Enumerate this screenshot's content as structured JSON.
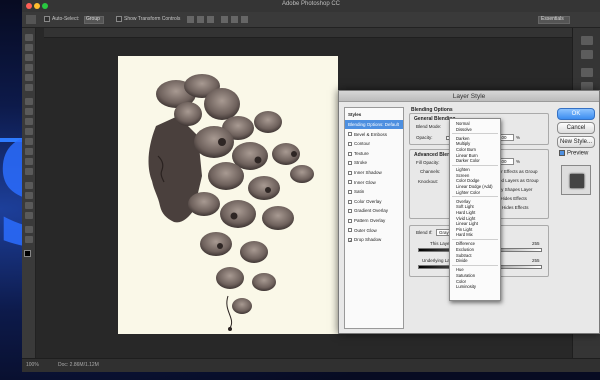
{
  "app": {
    "title": "Adobe Photoshop CC",
    "options_bar": {
      "auto_select": "Auto-Select:",
      "group": "Group",
      "transform_controls": "Show Transform Controls",
      "workspace": "Essentials"
    },
    "status": {
      "zoom": "100%",
      "doc_size": "Doc: 2.86M/1.12M"
    }
  },
  "dialog": {
    "title": "Layer Style",
    "styles_header": "Styles",
    "styles": [
      {
        "label": "Blending Options: Default",
        "checkbox": false,
        "checked": false,
        "selected": true
      },
      {
        "label": "Bevel & Emboss",
        "checkbox": true,
        "checked": false,
        "selected": false
      },
      {
        "label": "Contour",
        "checkbox": true,
        "checked": false,
        "selected": false
      },
      {
        "label": "Texture",
        "checkbox": true,
        "checked": false,
        "selected": false
      },
      {
        "label": "Stroke",
        "checkbox": true,
        "checked": false,
        "selected": false
      },
      {
        "label": "Inner Shadow",
        "checkbox": true,
        "checked": false,
        "selected": false
      },
      {
        "label": "Inner Glow",
        "checkbox": true,
        "checked": false,
        "selected": false
      },
      {
        "label": "Satin",
        "checkbox": true,
        "checked": false,
        "selected": false
      },
      {
        "label": "Color Overlay",
        "checkbox": true,
        "checked": false,
        "selected": false
      },
      {
        "label": "Gradient Overlay",
        "checkbox": true,
        "checked": false,
        "selected": false
      },
      {
        "label": "Pattern Overlay",
        "checkbox": true,
        "checked": false,
        "selected": false
      },
      {
        "label": "Outer Glow",
        "checkbox": true,
        "checked": false,
        "selected": false
      },
      {
        "label": "Drop Shadow",
        "checkbox": true,
        "checked": true,
        "selected": false
      }
    ],
    "blending_options": "Blending Options",
    "general_blending": "General Blending",
    "blend_mode_label": "Blend Mode:",
    "opacity_label": "Opacity:",
    "opacity_value": "100",
    "percent": "%",
    "advanced_blending": "Advanced Blending",
    "fill_opacity_label": "Fill Opacity:",
    "fill_opacity_value": "100",
    "channels_label": "Channels:",
    "knockout_label": "Knockout:",
    "adv_options": [
      "Blend Interior Effects as Group",
      "Blend Clipped Layers as Group",
      "Transparency Shapes Layer",
      "Layer Mask Hides Effects",
      "Vector Mask Hides Effects"
    ],
    "blend_if_label": "Blend If:",
    "blend_if_value": "Gray",
    "this_layer_label": "This Layer:",
    "this_layer_values": [
      "0",
      "255"
    ],
    "underlying_label": "Underlying Layer:",
    "underlying_values": [
      "0",
      "255"
    ],
    "ok": "OK",
    "cancel": "Cancel",
    "new_style": "New Style...",
    "preview": "Preview"
  },
  "blend_modes": [
    [
      "Normal",
      "Dissolve"
    ],
    [
      "Darken",
      "Multiply",
      "Color Burn",
      "Linear Burn",
      "Darker Color"
    ],
    [
      "Lighten",
      "Screen",
      "Color Dodge",
      "Linear Dodge (Add)",
      "Lighter Color"
    ],
    [
      "Overlay",
      "Soft Light",
      "Hard Light",
      "Vivid Light",
      "Linear Light",
      "Pin Light",
      "Hard Mix"
    ],
    [
      "Difference",
      "Exclusion",
      "Subtract",
      "Divide"
    ],
    [
      "Hue",
      "Saturation",
      "Color",
      "Luminosity"
    ]
  ],
  "colors": {
    "accent": "#4d8fe0",
    "canvas_bg": "#faf8e8",
    "background_brand": "#2b6dff"
  },
  "background_text": "S"
}
